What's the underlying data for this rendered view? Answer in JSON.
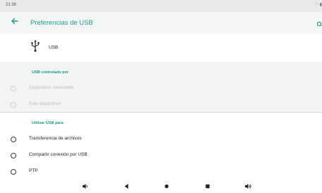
{
  "status_bar": {
    "time": "21:36",
    "status_icons": "♡ ▮"
  },
  "app_bar": {
    "title": "Preferencias de USB",
    "back_icon": "arrow-back-icon",
    "search_icon": "search-icon"
  },
  "usb": {
    "label": "USB",
    "icon": "usb-icon"
  },
  "controlled_by": {
    "heading": "USB controlado por",
    "options": [
      {
        "label": "Dispositivo conectado",
        "enabled": false,
        "selected": false
      },
      {
        "label": "Este dispositivo",
        "enabled": false,
        "selected": false
      }
    ]
  },
  "use_usb_for": {
    "heading": "Utilizar USB para",
    "options": [
      {
        "label": "Transferencia de archivos",
        "enabled": true,
        "selected": false
      },
      {
        "label": "Compartir conexión por USB",
        "enabled": true,
        "selected": false
      },
      {
        "label": "PTP",
        "enabled": true,
        "selected": false
      }
    ]
  },
  "nav_bar": {
    "items": [
      "volume-down-icon",
      "back-triangle-icon",
      "home-dot-icon",
      "recents-square-icon",
      "volume-up-icon"
    ]
  },
  "colors": {
    "accent": "#1a9c8c",
    "band": "#f2f4f3",
    "statusbar": "#e8ebea"
  }
}
